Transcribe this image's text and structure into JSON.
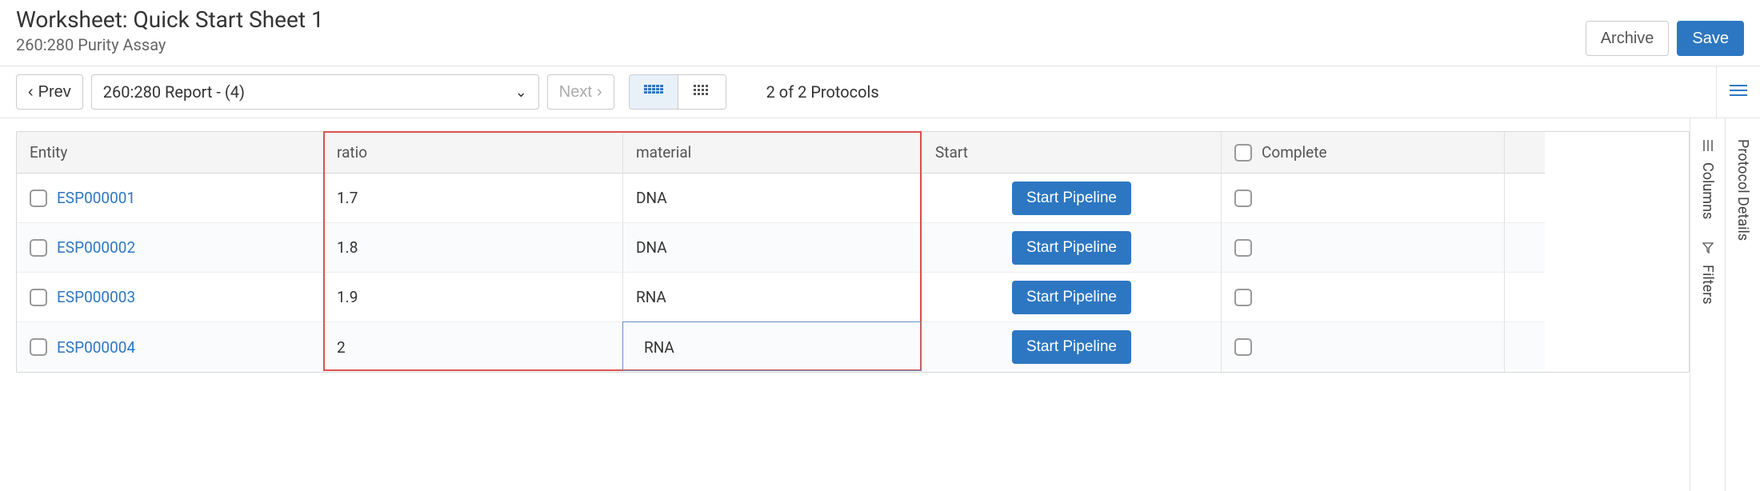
{
  "header": {
    "title": "Worksheet: Quick Start Sheet 1",
    "subtitle": "260:280 Purity Assay",
    "archive_label": "Archive",
    "save_label": "Save"
  },
  "toolbar": {
    "prev_label": "Prev",
    "next_label": "Next",
    "select_value": "260:280 Report - (4)",
    "protocol_count": "2 of 2 Protocols"
  },
  "columns": {
    "entity": "Entity",
    "ratio": "ratio",
    "material": "material",
    "start": "Start",
    "complete": "Complete"
  },
  "rows": [
    {
      "entity": "ESP000001",
      "ratio": "1.7",
      "material": "DNA",
      "start_label": "Start Pipeline"
    },
    {
      "entity": "ESP000002",
      "ratio": "1.8",
      "material": "DNA",
      "start_label": "Start Pipeline"
    },
    {
      "entity": "ESP000003",
      "ratio": "1.9",
      "material": "RNA",
      "start_label": "Start Pipeline"
    },
    {
      "entity": "ESP000004",
      "ratio": "2",
      "material": "RNA",
      "start_label": "Start Pipeline"
    }
  ],
  "rail": {
    "columns_label": "Columns",
    "filters_label": "Filters",
    "details_label": "Protocol Details"
  }
}
